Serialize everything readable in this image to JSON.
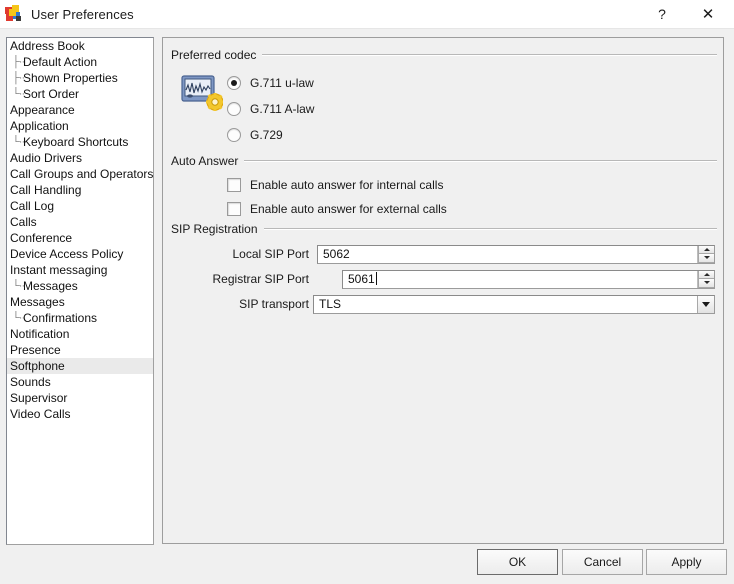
{
  "window": {
    "title": "User Preferences",
    "icon": "app-pinwheel-icon",
    "help_label": "?",
    "close_label": "✕"
  },
  "sidebar": {
    "name": "preferences-category-tree",
    "selected": "Softphone",
    "items": [
      {
        "label": "Address Book",
        "level": 0
      },
      {
        "label": "Default Action",
        "level": 1
      },
      {
        "label": "Shown Properties",
        "level": 1
      },
      {
        "label": "Sort Order",
        "level": 1
      },
      {
        "label": "Appearance",
        "level": 0
      },
      {
        "label": "Application",
        "level": 0
      },
      {
        "label": "Keyboard Shortcuts",
        "level": 1
      },
      {
        "label": "Audio Drivers",
        "level": 0
      },
      {
        "label": "Call Groups and Operators",
        "level": 0
      },
      {
        "label": "Call Handling",
        "level": 0
      },
      {
        "label": "Call Log",
        "level": 0
      },
      {
        "label": "Calls",
        "level": 0
      },
      {
        "label": "Conference",
        "level": 0
      },
      {
        "label": "Device Access Policy",
        "level": 0
      },
      {
        "label": "Instant messaging",
        "level": 0
      },
      {
        "label": "Messages",
        "level": 1
      },
      {
        "label": "Messages",
        "level": 0
      },
      {
        "label": "Confirmations",
        "level": 1
      },
      {
        "label": "Notification",
        "level": 0
      },
      {
        "label": "Presence",
        "level": 0
      },
      {
        "label": "Softphone",
        "level": 0
      },
      {
        "label": "Sounds",
        "level": 0
      },
      {
        "label": "Supervisor",
        "level": 0
      },
      {
        "label": "Video Calls",
        "level": 0
      }
    ]
  },
  "codec_group": {
    "title": "Preferred codec",
    "icon": "audio-codec-settings-icon",
    "options": [
      {
        "label": "G.711 u-law",
        "checked": true
      },
      {
        "label": "G.711 A-law",
        "checked": false
      },
      {
        "label": "G.729",
        "checked": false
      }
    ]
  },
  "auto_answer_group": {
    "title": "Auto Answer",
    "options": [
      {
        "label": "Enable auto answer for internal calls",
        "checked": false
      },
      {
        "label": "Enable auto answer for external calls",
        "checked": false
      }
    ]
  },
  "sip_group": {
    "title": "SIP Registration",
    "local_port": {
      "label": "Local SIP Port",
      "value": "5062"
    },
    "registrar_port": {
      "label": "Registrar SIP Port",
      "value": "5061",
      "focused": true
    },
    "transport": {
      "label": "SIP transport",
      "value": "TLS"
    }
  },
  "footer": {
    "ok_label": "OK",
    "cancel_label": "Cancel",
    "apply_label": "Apply"
  },
  "colors": {
    "window_bg": "#f0f0f0",
    "panel_bg": "#ffffff",
    "selection": "#eaeaea",
    "border": "#9d9d9d",
    "icon_gold": "#f0c020",
    "icon_blue": "#3a5fa0"
  }
}
